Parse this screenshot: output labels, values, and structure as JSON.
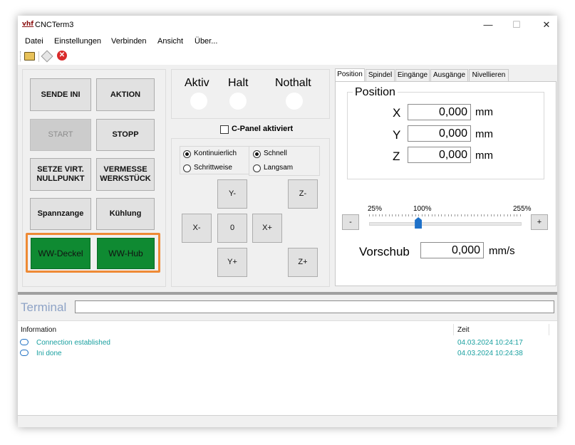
{
  "window": {
    "title": "CNCTerm3",
    "app_icon_text": "vhf",
    "min_glyph": "—",
    "max_glyph": "☐",
    "close_glyph": "✕"
  },
  "menu": {
    "items": [
      "Datei",
      "Einstellungen",
      "Verbinden",
      "Ansicht",
      "Über..."
    ]
  },
  "toolbar": {
    "icons": [
      "open-folder-icon",
      "connect-icon",
      "close-icon"
    ],
    "close_glyph": "✕"
  },
  "controls": {
    "sende_ini": "SENDE INI",
    "aktion": "AKTION",
    "start": "START",
    "stopp": "STOPP",
    "setze_virt_nullpunkt": "SETZE VIRT. NULLPUNKT",
    "vermesse_werkstueck": "VERMESSE WERKSTÜCK",
    "spannzange": "Spannzange",
    "kuehlung": "Kühlung",
    "ww_deckel": "WW-Deckel",
    "ww_hub": "WW-Hub",
    "highlight_color": "#ee8a35",
    "green_color": "#0f8a32"
  },
  "status": {
    "aktiv": "Aktiv",
    "halt": "Halt",
    "nothalt": "Nothalt"
  },
  "cpanel": {
    "label": "C-Panel aktiviert",
    "checked": false
  },
  "jog": {
    "kontinuierlich": "Kontinuierlich",
    "schrittweise": "Schrittweise",
    "schnell": "Schnell",
    "langsam": "Langsam",
    "mode_selected": "Kontinuierlich",
    "speed_selected": "Schnell",
    "y_minus": "Y-",
    "z_minus": "Z-",
    "x_minus": "X-",
    "zero": "0",
    "x_plus": "X+",
    "y_plus": "Y+",
    "z_plus": "Z+"
  },
  "tabs": {
    "items": [
      "Position",
      "Spindel",
      "Eingänge",
      "Ausgänge",
      "Nivellieren"
    ],
    "active": "Position"
  },
  "position": {
    "title": "Position",
    "x_label": "X",
    "x_value": "0,000",
    "y_label": "Y",
    "y_value": "0,000",
    "z_label": "Z",
    "z_value": "0,000",
    "unit": "mm"
  },
  "feed": {
    "min_label": "25%",
    "mid_label": "100%",
    "max_label": "255%",
    "minus": "-",
    "plus": "+",
    "slider_value_percent": 100,
    "vorschub_label": "Vorschub",
    "vorschub_value": "0,000",
    "vorschub_unit": "mm/s"
  },
  "terminal": {
    "label": "Terminal",
    "input_value": ""
  },
  "log": {
    "col_information": "Information",
    "col_zeit": "Zeit",
    "rows": [
      {
        "message": "Connection established",
        "time": "04.03.2024 10:24:17"
      },
      {
        "message": "Ini done",
        "time": "04.03.2024 10:24:38"
      }
    ]
  }
}
